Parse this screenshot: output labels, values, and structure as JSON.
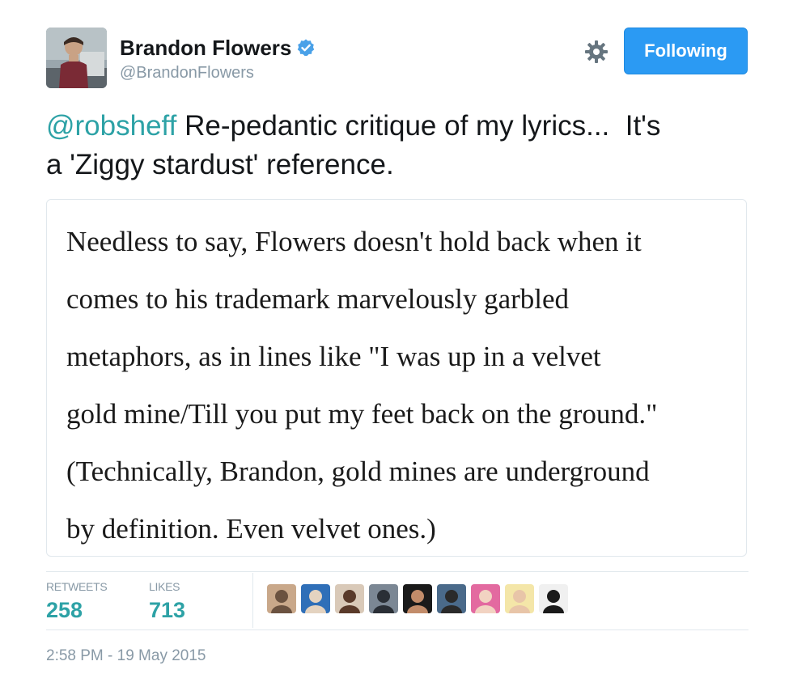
{
  "author": {
    "display_name": "Brandon Flowers",
    "handle": "@BrandonFlowers",
    "verified": true,
    "avatar_icon": "profile-photo"
  },
  "actions": {
    "follow_label": "Following",
    "settings_icon": "gear-icon",
    "accent_color": "#2b9af3"
  },
  "tweet": {
    "mention": "@robsheff",
    "text_line1_rest": " Re-pedantic critique of my lyrics...  It's",
    "text_line2": "a 'Ziggy stardust' reference."
  },
  "quote_card": {
    "lines": [
      "Needless to say, Flowers doesn't hold back when it",
      "comes to his trademark marvelously garbled",
      "metaphors, as in lines like \"I was up in a velvet",
      "gold mine/Till you put my feet back on the ground.\"",
      "(Technically, Brandon, gold mines are underground",
      "by definition. Even velvet ones.)"
    ]
  },
  "stats": {
    "retweets_label": "RETWEETS",
    "retweets_value": "258",
    "likes_label": "LIKES",
    "likes_value": "713",
    "stat_color": "#2da2a6"
  },
  "likers": [
    {
      "name": "liker-avatar-1",
      "colors": [
        "#c9a88a",
        "#6b5240"
      ]
    },
    {
      "name": "liker-avatar-2",
      "colors": [
        "#2f6fb8",
        "#e4d3c0"
      ]
    },
    {
      "name": "liker-avatar-3",
      "colors": [
        "#d9c9b8",
        "#5a3a2a"
      ]
    },
    {
      "name": "liker-avatar-4",
      "colors": [
        "#7b8794",
        "#2a2f36"
      ]
    },
    {
      "name": "liker-avatar-5",
      "colors": [
        "#1a1a1a",
        "#c28c6a"
      ]
    },
    {
      "name": "liker-avatar-6",
      "colors": [
        "#4a6a8a",
        "#2a2a2a"
      ]
    },
    {
      "name": "liker-avatar-7",
      "colors": [
        "#e36aa0",
        "#f2d3c2"
      ]
    },
    {
      "name": "liker-avatar-8",
      "colors": [
        "#f4e6a8",
        "#e8c5a8"
      ]
    },
    {
      "name": "liker-avatar-9",
      "colors": [
        "#f0f0f0",
        "#1a1a1a"
      ]
    }
  ],
  "timestamp": "2:58 PM - 19 May 2015"
}
